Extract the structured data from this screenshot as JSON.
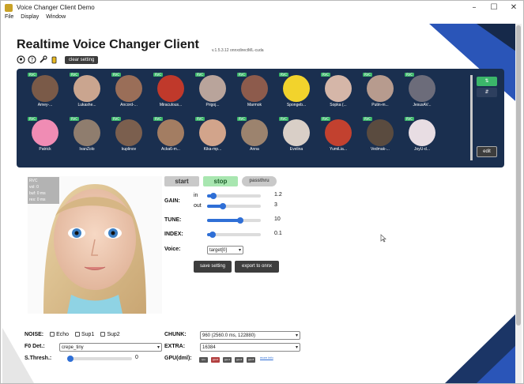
{
  "window": {
    "title": "Voice Changer Client Demo",
    "controls": {
      "minimize": "–",
      "maximize": "☐",
      "close": "✕"
    }
  },
  "menu": {
    "items": [
      "File",
      "Display",
      "Window"
    ]
  },
  "header": {
    "title": "Realtime Voice Changer Client",
    "version": "v.1.5.3.12  onnxdirectML-cuda",
    "clear_label": "clear setting"
  },
  "models": {
    "badge": "RVC",
    "names": [
      "Amey-...",
      "Lukashe...",
      "Ancord-...",
      "Miraculous...",
      "Prigoj...",
      "Marmok",
      "Spongeb...",
      "Sopka (...",
      "Putin-m...",
      "JesusAV...",
      "Patrick",
      "IvanZolo",
      "kuplinov",
      "Acka6-m...",
      "Kika-mp...",
      "Anna",
      "Evelina",
      "YumiLia...",
      "Vedmak-...",
      "JoyU-d..."
    ],
    "edit_label": "edit",
    "sort_up": "⇅",
    "sort_down": "⇵"
  },
  "stats": {
    "line1": "RVC",
    "line2": "vol: 0",
    "line3": "buf: 0 ms",
    "line4": "res: 0 ms"
  },
  "controls": {
    "start": "start",
    "stop": "stop",
    "passthru": "passthru",
    "gain_label": "GAIN:",
    "in_label": "in",
    "out_label": "out",
    "in_value": "1.2",
    "out_value": "3",
    "tune_label": "TUNE:",
    "tune_value": "10",
    "index_label": "INDEX:",
    "index_value": "0.1",
    "voice_label": "Voice:",
    "voice_value": "target[0]",
    "save_label": "save setting",
    "export_label": "export to onnx"
  },
  "levels": {
    "in": 0.12,
    "out": 0.3,
    "tune": 0.62,
    "index": 0.1,
    "sthresh": 0.02
  },
  "bottom": {
    "noise_label": "NOISE:",
    "echo": "Echo",
    "sup1": "Sup1",
    "sup2": "Sup2",
    "f0_label": "F0 Det.:",
    "f0_value": "crepe_tiny",
    "sthresh_label": "S.Thresh.:",
    "sthresh_value": "0",
    "chunk_label": "CHUNK:",
    "chunk_value": "960 (2560.0 ms, 122880)",
    "extra_label": "EXTRA:",
    "extra_value": "16384",
    "gpu_label": "GPU(dml):",
    "gpu_items": [
      "cpu",
      "gpu0",
      "gpu1",
      "gpu2",
      "gpu3"
    ],
    "gpu_more": "more info"
  },
  "colors": {
    "panel": "#1a2f4f",
    "accent": "#2f6fd6",
    "badge": "#3bb66a",
    "stop_active": "#a8e6b0"
  }
}
